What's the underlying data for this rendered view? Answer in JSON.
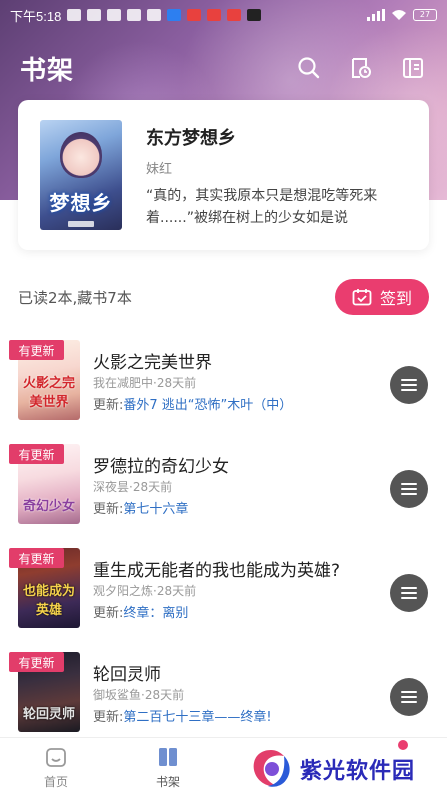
{
  "status_bar": {
    "time": "下午5:18",
    "battery": "27"
  },
  "header": {
    "title": "书架",
    "icons": [
      "search-icon",
      "history-icon",
      "menu-icon"
    ]
  },
  "featured": {
    "cover_title": "梦想乡",
    "title": "东方梦想乡",
    "author": "妹红",
    "description": "“真的，其实我原本只是想混吃等死来着......”被绑在树上的少女如是说"
  },
  "summary": {
    "text": "已读2本,藏书7本",
    "signin_label": "签到"
  },
  "books": [
    {
      "badge": "有更新",
      "cover_text": "火影之完美世界",
      "title": "火影之完美世界",
      "meta": "我在减肥中·28天前",
      "update_label": "更新:",
      "chapter": "番外7 逃出“恐怖”木叶（中）"
    },
    {
      "badge": "有更新",
      "cover_text": "奇幻少女",
      "title": "罗德拉的奇幻少女",
      "meta": "深夜昙·28天前",
      "update_label": "更新:",
      "chapter": "第七十六章"
    },
    {
      "badge": "有更新",
      "cover_text": "也能成为英雄",
      "title": "重生成无能者的我也能成为英雄?",
      "meta": "观夕阳之炼·28天前",
      "update_label": "更新:",
      "chapter": "终章：离别"
    },
    {
      "badge": "有更新",
      "cover_text": "轮回灵师",
      "title": "轮回灵师",
      "meta": "御坂鲨鱼·28天前",
      "update_label": "更新:",
      "chapter": "第二百七十三章——终章!"
    }
  ],
  "bottom_nav": {
    "items": [
      {
        "label": "首页",
        "icon": "home-icon"
      },
      {
        "label": "书架",
        "icon": "bookshelf-icon"
      }
    ]
  },
  "watermark": {
    "text": "紫光软件园"
  },
  "colors": {
    "accent": "#ea3d6f",
    "link": "#2f6fc4",
    "watermark": "#2a2ab8"
  }
}
